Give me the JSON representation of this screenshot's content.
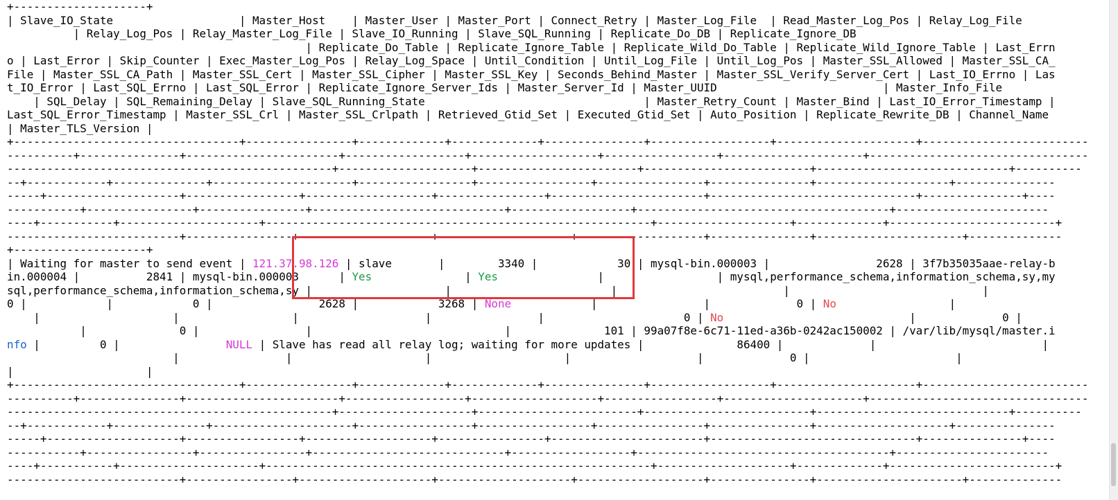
{
  "terminal": {
    "lines": [
      {
        "segments": [
          {
            "text": "+--------------------+"
          }
        ]
      },
      {
        "segments": [
          {
            "text": "| Slave_IO_State                   | Master_Host    | Master_User | Master_Port | Connect_Retry | Master_Log_File  | Read_Master_Log_Pos | Relay_Log_File"
          }
        ]
      },
      {
        "segments": [
          {
            "text": "          | Relay_Log_Pos | Relay_Master_Log_File | Slave_IO_Running | Slave_SQL_Running | Replicate_Do_DB | Replicate_Ignore_DB"
          }
        ]
      },
      {
        "segments": [
          {
            "text": "                                             | Replicate_Do_Table | Replicate_Ignore_Table | Replicate_Wild_Do_Table | Replicate_Wild_Ignore_Table | Last_Errn"
          }
        ]
      },
      {
        "segments": [
          {
            "text": "o | Last_Error | Skip_Counter | Exec_Master_Log_Pos | Relay_Log_Space | Until_Condition | Until_Log_File | Until_Log_Pos | Master_SSL_Allowed | Master_SSL_CA_"
          }
        ]
      },
      {
        "segments": [
          {
            "text": "File | Master_SSL_CA_Path | Master_SSL_Cert | Master_SSL_Cipher | Master_SSL_Key | Seconds_Behind_Master | Master_SSL_Verify_Server_Cert | Last_IO_Errno | Las"
          }
        ]
      },
      {
        "segments": [
          {
            "text": "t_IO_Error | Last_SQL_Errno | Last_SQL_Error | Replicate_Ignore_Server_Ids | Master_Server_Id | Master_UUID                         | Master_Info_File"
          }
        ]
      },
      {
        "segments": [
          {
            "text": "    | SQL_Delay | SQL_Remaining_Delay | Slave_SQL_Running_State                                 | Master_Retry_Count | Master_Bind | Last_IO_Error_Timestamp |"
          }
        ]
      },
      {
        "segments": [
          {
            "text": "Last_SQL_Error_Timestamp | Master_SSL_Crl | Master_SSL_Crlpath | Retrieved_Gtid_Set | Executed_Gtid_Set | Auto_Position | Replicate_Rewrite_DB | Channel_Name"
          }
        ]
      },
      {
        "segments": [
          {
            "text": "| Master_TLS_Version |"
          }
        ]
      },
      {
        "segments": [
          {
            "text": "+----------------------------------+----------------+-------------+-------------+---------------+------------------+---------------------+------------------------------"
          }
        ]
      },
      {
        "segments": [
          {
            "text": "----------+---------------+-----------------------+------------------+-------------------+-----------------+---------------------+---------------------------------"
          }
        ]
      },
      {
        "segments": [
          {
            "text": "-------------------------------------------------+--------------------+------------------------+-------------------------+-----------------------------+----------"
          }
        ]
      },
      {
        "segments": [
          {
            "text": "--+------------+--------------+---------------------+-----------------+-----------------+----------------+---------------+--------------------+---------------"
          }
        ]
      },
      {
        "segments": [
          {
            "text": "-----+--------------------+-----------------+-------------------+----------------+-----------------------+-------------------------------+---------------+----"
          }
        ]
      },
      {
        "segments": [
          {
            "text": "-----------+----------------+----------------+-----------------------------+------------------+--------------------------------------+-----------------------"
          }
        ]
      },
      {
        "segments": [
          {
            "text": "----+-----------+---------------------+----------------------------------------------------------+--------------------+-------------+-------------------------+"
          }
        ]
      },
      {
        "segments": [
          {
            "text": "--------------------------+----------------+--------------------+--------------------+-------------------+---------------+----------------------+--------------"
          }
        ]
      },
      {
        "segments": [
          {
            "text": "+--------------------+"
          }
        ]
      },
      {
        "segments": [
          {
            "text": "| Waiting for master to send event | "
          },
          {
            "text": "121.37.98.126",
            "cls": "seg-ip"
          },
          {
            "text": " | slave       |        3340 |            30 | mysql-bin.000003 |                2628 | 3f7b35035aae-relay-b"
          }
        ]
      },
      {
        "segments": [
          {
            "text": "in.000004 |          2841 | mysql-bin.000003      | "
          },
          {
            "text": "Yes",
            "cls": "seg-yes"
          },
          {
            "text": "              | "
          },
          {
            "text": "Yes",
            "cls": "seg-yes"
          },
          {
            "text": "               |                 | mysql,performance_schema,information_schema,sy,my"
          }
        ]
      },
      {
        "segments": [
          {
            "text": "sql,performance_schema,information_schema,sy |                    |                        |                         |                             |"
          }
        ]
      },
      {
        "segments": [
          {
            "text": "0 |            |            0 |                2628 |            3268 | "
          },
          {
            "text": "None",
            "cls": "seg-none"
          },
          {
            "text": "            |                |             0 | "
          },
          {
            "text": "No",
            "cls": "seg-no"
          },
          {
            "text": "                 |"
          }
        ]
      },
      {
        "segments": [
          {
            "text": "    |                    |                 |                   |                |                     0 | "
          },
          {
            "text": "No",
            "cls": "seg-no"
          },
          {
            "text": "                            |             0 |"
          }
        ]
      },
      {
        "segments": [
          {
            "text": "           |              0 |                |                             |              101 | 99a07f8e-6c71-11ed-a36b-0242ac150002 | /var/lib/mysql/master.i"
          }
        ]
      },
      {
        "segments": [
          {
            "text": "nfo",
            "cls": "seg-info"
          },
          {
            "text": " |         0 |                "
          },
          {
            "text": "NULL",
            "cls": "seg-null"
          },
          {
            "text": " | Slave has read all relay log; waiting for more updates |              86400 |             |                         |"
          }
        ]
      },
      {
        "segments": [
          {
            "text": "                         |                |                    |                    |                   |             0 |                      |"
          }
        ]
      },
      {
        "segments": [
          {
            "text": "|                    |"
          }
        ]
      },
      {
        "segments": [
          {
            "text": "+----------------------------------+----------------+-------------+-------------+---------------+------------------+---------------------+------------------------------"
          }
        ]
      },
      {
        "segments": [
          {
            "text": "----------+---------------+-----------------------+------------------+-------------------+-----------------+---------------------+---------------------------------"
          }
        ]
      },
      {
        "segments": [
          {
            "text": "-------------------------------------------------+--------------------+------------------------+-------------------------+-----------------------------+----------"
          }
        ]
      },
      {
        "segments": [
          {
            "text": "--+------------+--------------+---------------------+-----------------+-----------------+----------------+---------------+--------------------+---------------"
          }
        ]
      },
      {
        "segments": [
          {
            "text": "-----+--------------------+-----------------+-------------------+----------------+-----------------------+-------------------------------+---------------+----"
          }
        ]
      },
      {
        "segments": [
          {
            "text": "-----------+----------------+----------------+-----------------------------+------------------+--------------------------------------+-----------------------"
          }
        ]
      },
      {
        "segments": [
          {
            "text": "----+-----------+---------------------+----------------------------------------------------------+--------------------+-------------+-------------------------+"
          }
        ]
      },
      {
        "segments": [
          {
            "text": "--------------------------+----------------+--------------------+--------------------+-------------------+---------------+----------------------+--------------"
          }
        ]
      }
    ]
  }
}
